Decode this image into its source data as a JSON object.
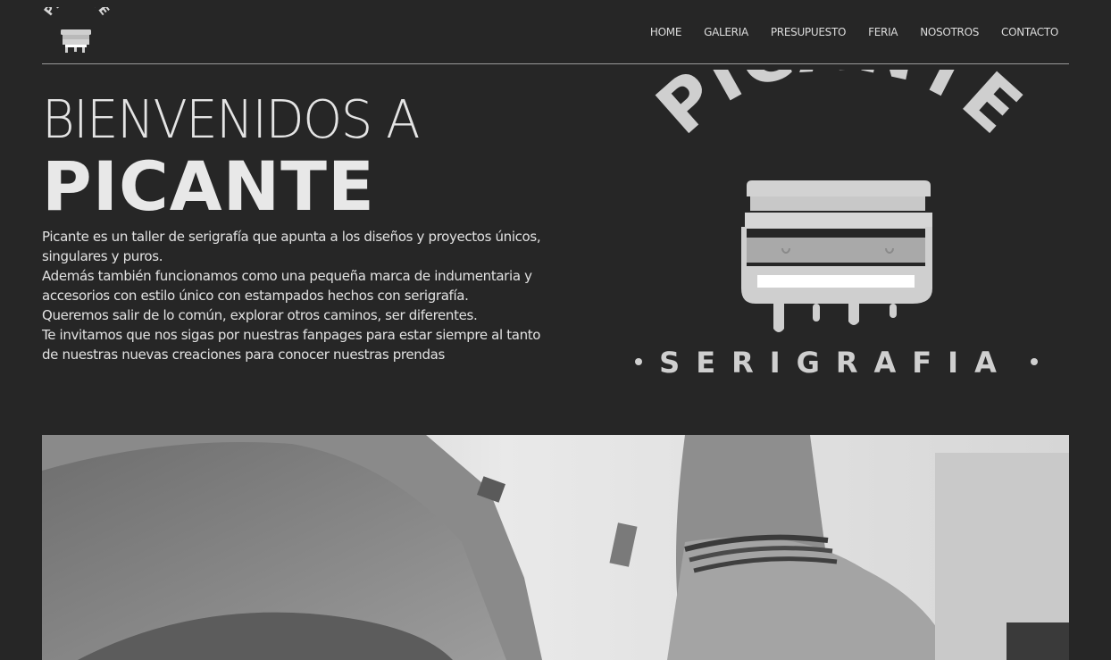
{
  "logo": {
    "small_text": "PICANTE",
    "arc_text": "PICANTE",
    "sub_text": "SERIGRAFIA"
  },
  "nav": {
    "items": [
      "HOME",
      "GALERIA",
      "PRESUPUESTO",
      "FERIA",
      "NOSOTROS",
      "CONTACTO"
    ]
  },
  "hero": {
    "welcome": "BIENVENIDOS A",
    "title": "PICANTE",
    "paragraphs": [
      "Picante es un taller de serigrafía que apunta a los diseños y proyectos únicos, singulares y puros.",
      "Además también funcionamos como una pequeña marca de indumentaria y accesorios con estilo único con estampados hechos con serigrafía.",
      "Queremos salir de lo común, explorar otros caminos, ser diferentes.",
      "Te invitamos que nos sigas por nuestras fanpages para estar siempre al tanto de nuestras nuevas creaciones para conocer nuestras prendas"
    ]
  },
  "colors": {
    "background": "#262626",
    "text": "#e6e6e6",
    "logo": "#cfcfcf"
  }
}
